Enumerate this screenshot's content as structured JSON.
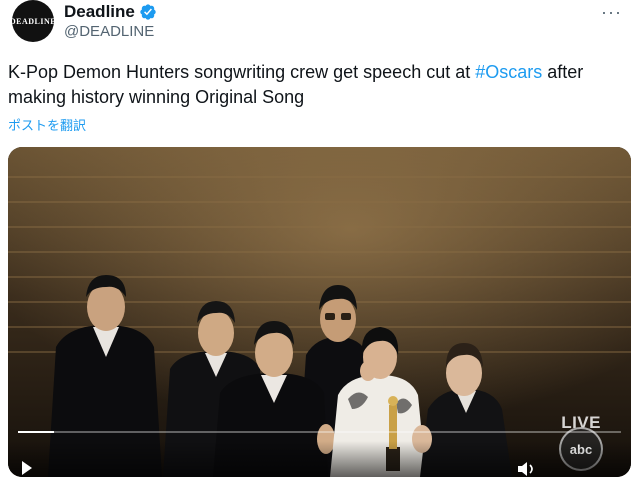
{
  "tweet": {
    "avatar_text": "DEADLINE",
    "display_name": "Deadline",
    "handle": "@DEADLINE",
    "text_before": "K-Pop Demon Hunters songwriting crew get speech cut at ",
    "hashtag": "#Oscars",
    "text_after": " after making history winning Original Song",
    "translate_label": "ポストを翻訳",
    "more_label": "···"
  },
  "media": {
    "live_label": "LIVE",
    "network_label": "abc",
    "progress": 0.06
  },
  "colors": {
    "accent": "#1d9bf0",
    "text": "#0f1419",
    "secondary": "#536471"
  }
}
